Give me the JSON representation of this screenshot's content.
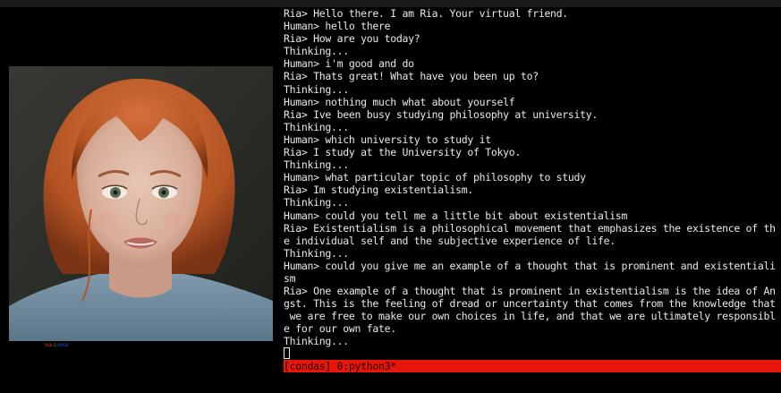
{
  "terminal": {
    "lines": [
      "Ria> Hello there. I am Ria. Your virtual friend.",
      "Human> hello there",
      "Ria> How are you today?",
      "Thinking...",
      "Human> i'm good and do",
      "Ria> Thats great! What have you been up to?",
      "Thinking...",
      "Human> nothing much what about yourself",
      "Ria> Ive been busy studying philosophy at university.",
      "Thinking...",
      "Human> which university to study it",
      "Ria> I study at the University of Tokyo.",
      "Thinking...",
      "Human> what particular topic of philosophy to study",
      "Ria> Im studying existentialism.",
      "Thinking...",
      "Human> could you tell me a little bit about existentialism",
      "Ria> Existentialism is a philosophical movement that emphasizes the existence of th",
      "e individual self and the subjective experience of life.",
      "Thinking...",
      "Human> could you give me an example of a thought that is prominent and existentiali",
      "sm",
      "Ria> One example of a thought that is prominent in existentialism is the idea of An",
      "gst. This is the feeling of dread or uncertainty that comes from the knowledge that",
      " we are free to make our own choices in life, and that we are ultimately responsibl",
      "e for our own fate.",
      "Thinking..."
    ]
  },
  "status_bar": {
    "text": "[condas] 0:python3*"
  },
  "avatar": {
    "rgb_label": [
      "RGB",
      "G",
      "MRGB"
    ]
  },
  "colors": {
    "terminal_background": "#000000",
    "terminal_text": "#e9e9e9",
    "status_bar": "#e8150b",
    "status_text": "#1a0200",
    "rgb_r": "#ff3030",
    "rgb_g": "#30c030",
    "rgb_b": "#3050ff"
  },
  "icons": {
    "cursor": "block-cursor-icon"
  }
}
